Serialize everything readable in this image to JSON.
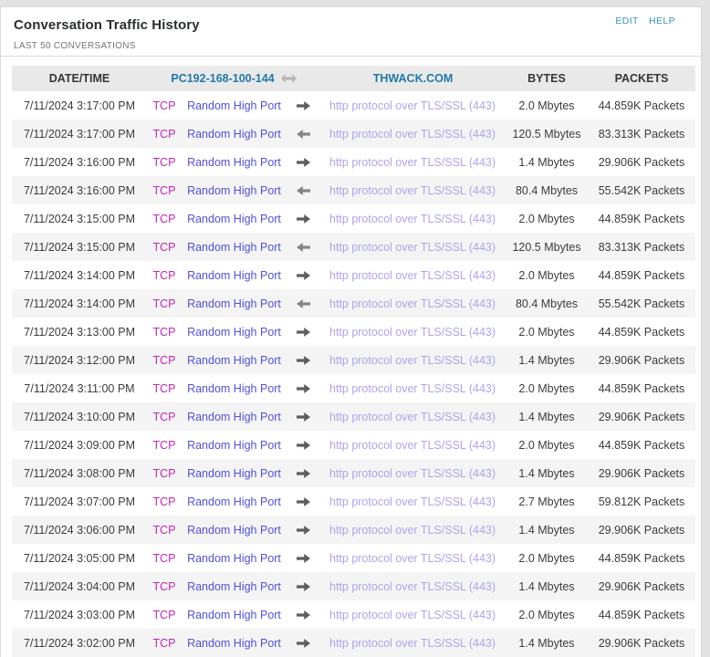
{
  "widget": {
    "title": "Conversation Traffic History",
    "subtitle": "LAST 50 CONVERSATIONS",
    "actions": {
      "edit": "EDIT",
      "help": "HELP"
    }
  },
  "table": {
    "headers": {
      "datetime": "DATE/TIME",
      "source": "PC192-168-100-144",
      "destination": "THWACK.COM",
      "bytes": "BYTES",
      "packets": "PACKETS"
    },
    "rows": [
      {
        "datetime": "7/11/2024 3:17:00 PM",
        "protocol": "TCP",
        "source_port": "Random High Port",
        "direction": "out",
        "service": "http protocol over TLS/SSL (443)",
        "bytes": "2.0 Mbytes",
        "packets": "44.859K Packets"
      },
      {
        "datetime": "7/11/2024 3:17:00 PM",
        "protocol": "TCP",
        "source_port": "Random High Port",
        "direction": "in",
        "service": "http protocol over TLS/SSL (443)",
        "bytes": "120.5 Mbytes",
        "packets": "83.313K Packets"
      },
      {
        "datetime": "7/11/2024 3:16:00 PM",
        "protocol": "TCP",
        "source_port": "Random High Port",
        "direction": "out",
        "service": "http protocol over TLS/SSL (443)",
        "bytes": "1.4 Mbytes",
        "packets": "29.906K Packets"
      },
      {
        "datetime": "7/11/2024 3:16:00 PM",
        "protocol": "TCP",
        "source_port": "Random High Port",
        "direction": "in",
        "service": "http protocol over TLS/SSL (443)",
        "bytes": "80.4 Mbytes",
        "packets": "55.542K Packets"
      },
      {
        "datetime": "7/11/2024 3:15:00 PM",
        "protocol": "TCP",
        "source_port": "Random High Port",
        "direction": "out",
        "service": "http protocol over TLS/SSL (443)",
        "bytes": "2.0 Mbytes",
        "packets": "44.859K Packets"
      },
      {
        "datetime": "7/11/2024 3:15:00 PM",
        "protocol": "TCP",
        "source_port": "Random High Port",
        "direction": "in",
        "service": "http protocol over TLS/SSL (443)",
        "bytes": "120.5 Mbytes",
        "packets": "83.313K Packets"
      },
      {
        "datetime": "7/11/2024 3:14:00 PM",
        "protocol": "TCP",
        "source_port": "Random High Port",
        "direction": "out",
        "service": "http protocol over TLS/SSL (443)",
        "bytes": "2.0 Mbytes",
        "packets": "44.859K Packets"
      },
      {
        "datetime": "7/11/2024 3:14:00 PM",
        "protocol": "TCP",
        "source_port": "Random High Port",
        "direction": "in",
        "service": "http protocol over TLS/SSL (443)",
        "bytes": "80.4 Mbytes",
        "packets": "55.542K Packets"
      },
      {
        "datetime": "7/11/2024 3:13:00 PM",
        "protocol": "TCP",
        "source_port": "Random High Port",
        "direction": "out",
        "service": "http protocol over TLS/SSL (443)",
        "bytes": "2.0 Mbytes",
        "packets": "44.859K Packets"
      },
      {
        "datetime": "7/11/2024 3:12:00 PM",
        "protocol": "TCP",
        "source_port": "Random High Port",
        "direction": "out",
        "service": "http protocol over TLS/SSL (443)",
        "bytes": "1.4 Mbytes",
        "packets": "29.906K Packets"
      },
      {
        "datetime": "7/11/2024 3:11:00 PM",
        "protocol": "TCP",
        "source_port": "Random High Port",
        "direction": "out",
        "service": "http protocol over TLS/SSL (443)",
        "bytes": "2.0 Mbytes",
        "packets": "44.859K Packets"
      },
      {
        "datetime": "7/11/2024 3:10:00 PM",
        "protocol": "TCP",
        "source_port": "Random High Port",
        "direction": "out",
        "service": "http protocol over TLS/SSL (443)",
        "bytes": "1.4 Mbytes",
        "packets": "29.906K Packets"
      },
      {
        "datetime": "7/11/2024 3:09:00 PM",
        "protocol": "TCP",
        "source_port": "Random High Port",
        "direction": "out",
        "service": "http protocol over TLS/SSL (443)",
        "bytes": "2.0 Mbytes",
        "packets": "44.859K Packets"
      },
      {
        "datetime": "7/11/2024 3:08:00 PM",
        "protocol": "TCP",
        "source_port": "Random High Port",
        "direction": "out",
        "service": "http protocol over TLS/SSL (443)",
        "bytes": "1.4 Mbytes",
        "packets": "29.906K Packets"
      },
      {
        "datetime": "7/11/2024 3:07:00 PM",
        "protocol": "TCP",
        "source_port": "Random High Port",
        "direction": "out",
        "service": "http protocol over TLS/SSL (443)",
        "bytes": "2.7 Mbytes",
        "packets": "59.812K Packets"
      },
      {
        "datetime": "7/11/2024 3:06:00 PM",
        "protocol": "TCP",
        "source_port": "Random High Port",
        "direction": "out",
        "service": "http protocol over TLS/SSL (443)",
        "bytes": "1.4 Mbytes",
        "packets": "29.906K Packets"
      },
      {
        "datetime": "7/11/2024 3:05:00 PM",
        "protocol": "TCP",
        "source_port": "Random High Port",
        "direction": "out",
        "service": "http protocol over TLS/SSL (443)",
        "bytes": "2.0 Mbytes",
        "packets": "44.859K Packets"
      },
      {
        "datetime": "7/11/2024 3:04:00 PM",
        "protocol": "TCP",
        "source_port": "Random High Port",
        "direction": "out",
        "service": "http protocol over TLS/SSL (443)",
        "bytes": "1.4 Mbytes",
        "packets": "29.906K Packets"
      },
      {
        "datetime": "7/11/2024 3:03:00 PM",
        "protocol": "TCP",
        "source_port": "Random High Port",
        "direction": "out",
        "service": "http protocol over TLS/SSL (443)",
        "bytes": "2.0 Mbytes",
        "packets": "44.859K Packets"
      },
      {
        "datetime": "7/11/2024 3:02:00 PM",
        "protocol": "TCP",
        "source_port": "Random High Port",
        "direction": "out",
        "service": "http protocol over TLS/SSL (443)",
        "bytes": "1.4 Mbytes",
        "packets": "29.906K Packets"
      }
    ]
  },
  "colors": {
    "tcp": "#c028b9",
    "port_link": "#5351d6",
    "service_link": "#aba6ea",
    "header_link": "#2278a8",
    "action_link": "#3d8fb5",
    "arrow_out": "#5d5e60",
    "arrow_in": "#858688"
  }
}
